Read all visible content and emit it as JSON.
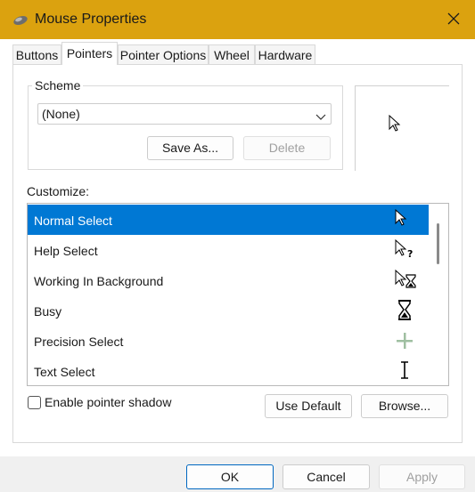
{
  "window": {
    "title": "Mouse Properties",
    "close_glyph": "✕"
  },
  "tabs": [
    {
      "label": "Buttons"
    },
    {
      "label": "Pointers",
      "active": true
    },
    {
      "label": "Pointer Options"
    },
    {
      "label": "Wheel"
    },
    {
      "label": "Hardware"
    }
  ],
  "scheme": {
    "legend": "Scheme",
    "selected": "(None)",
    "save_as_label": "Save As...",
    "delete_label": "Delete"
  },
  "customize": {
    "label": "Customize:",
    "items": [
      {
        "label": "Normal Select",
        "icon": "arrow-cursor-icon",
        "selected": true
      },
      {
        "label": "Help Select",
        "icon": "help-cursor-icon"
      },
      {
        "label": "Working In Background",
        "icon": "working-cursor-icon"
      },
      {
        "label": "Busy",
        "icon": "hourglass-cursor-icon"
      },
      {
        "label": "Precision Select",
        "icon": "crosshair-cursor-icon"
      },
      {
        "label": "Text Select",
        "icon": "ibeam-cursor-icon"
      }
    ]
  },
  "shadow": {
    "label": "Enable pointer shadow",
    "checked": false
  },
  "buttons": {
    "use_default": "Use Default",
    "browse": "Browse...",
    "ok": "OK",
    "cancel": "Cancel",
    "apply": "Apply"
  },
  "colors": {
    "titlebar": "#dba20f",
    "selection": "#0078d4"
  }
}
